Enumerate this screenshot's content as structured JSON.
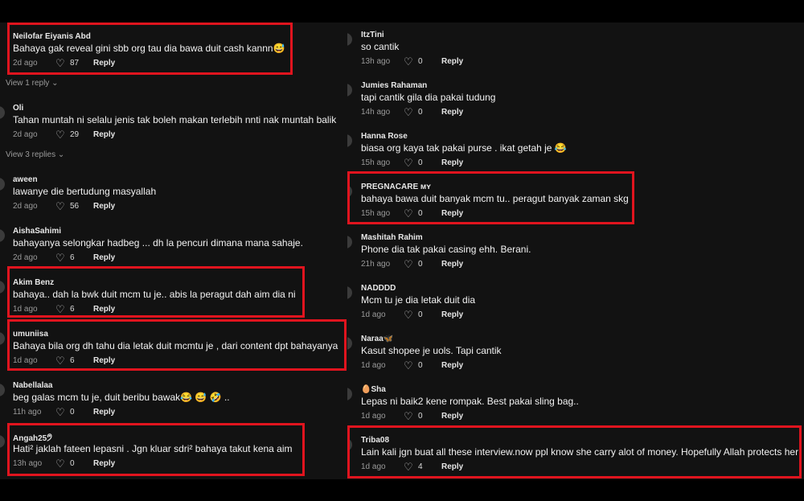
{
  "left_comments": [
    {
      "user": "Neilofar Eiyanis Abd",
      "text": "Bahaya gak reveal gini sbb org tau dia bawa duit cash kannn😅",
      "time": "2d ago",
      "likes": "87",
      "reply": "Reply"
    },
    {
      "user": "Oli",
      "text": "Tahan muntah ni selalu jenis tak boleh makan terlebih nnti nak muntah balik",
      "time": "2d ago",
      "likes": "29",
      "reply": "Reply"
    },
    {
      "user": "aween",
      "text": "lawanye die bertudung masyallah",
      "time": "2d ago",
      "likes": "56",
      "reply": "Reply"
    },
    {
      "user": "AishaSahimi",
      "text": "bahayanya selongkar hadbeg ... dh la pencuri dimana mana sahaje.",
      "time": "2d ago",
      "likes": "6",
      "reply": "Reply"
    },
    {
      "user": "Akim Benz",
      "text": "bahaya.. dah la bwk duit mcm tu je.. abis la peragut dah aim dia ni",
      "time": "1d ago",
      "likes": "6",
      "reply": "Reply"
    },
    {
      "user": "umuniisa",
      "text": "Bahaya bila org dh tahu dia letak duit mcmtu je , dari content dpt bahayanya",
      "time": "1d ago",
      "likes": "6",
      "reply": "Reply"
    },
    {
      "user": "Nabellalaa",
      "text": "beg galas mcm tu je, duit beribu bawak😂 😅 🤣 ..",
      "time": "11h ago",
      "likes": "0",
      "reply": "Reply"
    },
    {
      "user": "Angah25🤊",
      "text": "Hati² jaklah fateen lepasni . Jgn kluar sdri² bahaya takut kena aim",
      "time": "13h ago",
      "likes": "0",
      "reply": "Reply"
    }
  ],
  "view_replies": [
    "View 1 reply ⌄",
    "View 3 replies ⌄"
  ],
  "right_comments": [
    {
      "user": "ItzTini",
      "text": "so cantik",
      "time": "13h ago",
      "likes": "0",
      "reply": "Reply"
    },
    {
      "user": "Jumies Rahaman",
      "text": "tapi cantik gila dia pakai tudung",
      "time": "14h ago",
      "likes": "0",
      "reply": "Reply"
    },
    {
      "user": "Hanna Rose",
      "text": "biasa org kaya tak pakai purse . ikat getah je 😂",
      "time": "15h ago",
      "likes": "0",
      "reply": "Reply"
    },
    {
      "user": "PREGNACARE ᴍʏ",
      "text": "bahaya bawa duit banyak mcm tu.. peragut banyak zaman skg",
      "time": "15h ago",
      "likes": "0",
      "reply": "Reply"
    },
    {
      "user": "Mashitah Rahim",
      "text": "Phone dia tak pakai casing ehh. Berani.",
      "time": "21h ago",
      "likes": "0",
      "reply": "Reply"
    },
    {
      "user": "NADDDD",
      "text": "Mcm tu je dia letak duit dia",
      "time": "1d ago",
      "likes": "0",
      "reply": "Reply"
    },
    {
      "user": "Naraa🦋",
      "text": "Kasut shopee je uols. Tapi cantik",
      "time": "1d ago",
      "likes": "0",
      "reply": "Reply"
    },
    {
      "user": "🥚Sha",
      "text": "Lepas ni baik2 kene rompak. Best pakai sling bag..",
      "time": "1d ago",
      "likes": "0",
      "reply": "Reply"
    },
    {
      "user": "Triba08",
      "text": "Lain kali jgn buat all these interview.now ppl know she carry alot of money. Hopefully Allah protects her",
      "time": "1d ago",
      "likes": "4",
      "reply": "Reply"
    }
  ],
  "icons": {
    "like": "heart-outline-icon"
  },
  "colors": {
    "highlight": "#e0141e",
    "background": "#121212"
  }
}
